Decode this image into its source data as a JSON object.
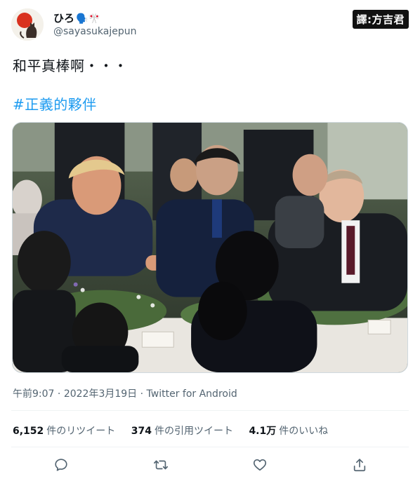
{
  "user": {
    "display_name": "ひろ",
    "display_name_emoji": "🗣️🎌",
    "handle": "@sayasukajepun"
  },
  "watermark": "譯:方吉君",
  "tweet": {
    "text": "和平真棒啊・・・",
    "hashtag": "#正義的夥伴"
  },
  "meta": {
    "time": "午前9:07",
    "date": "2022年3月19日",
    "source": "Twitter for Android",
    "separator": "·"
  },
  "stats": [
    {
      "num": "6,152",
      "label": "件のリツイート"
    },
    {
      "num": "374",
      "label": "件の引用ツイート"
    },
    {
      "num": "4.1万",
      "label": "件のいいね"
    }
  ],
  "actions": [
    {
      "name": "reply-icon"
    },
    {
      "name": "retweet-icon"
    },
    {
      "name": "like-icon"
    },
    {
      "name": "share-icon"
    }
  ],
  "colors": {
    "text": "#0f1419",
    "secondary": "#536471",
    "accent": "#1d9bf0",
    "divider": "#eff3f4"
  }
}
